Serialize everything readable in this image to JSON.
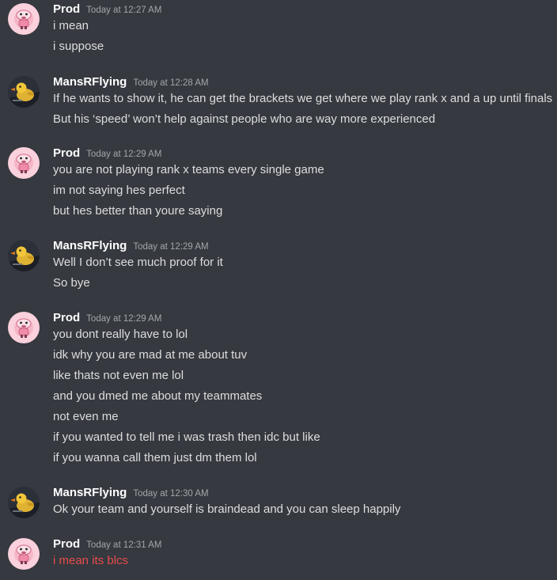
{
  "colors": {
    "background": "#36393f",
    "username": "#ffffff",
    "timestamp": "#a3a6aa",
    "message_text": "#dcddde",
    "highlight_text": "#e74c4c"
  },
  "groups": [
    {
      "author": "Prod",
      "avatar_icon": "pink-cartoon-avatar-icon",
      "timestamp": "Today at 12:27 AM",
      "lines": [
        {
          "text": "i mean"
        },
        {
          "text": "i suppose"
        }
      ]
    },
    {
      "author": "MansRFlying",
      "avatar_icon": "duck-avatar-icon",
      "timestamp": "Today at 12:28 AM",
      "lines": [
        {
          "text": "If he wants to show it, he can get the brackets we get where we play rank x and a up until finals"
        },
        {
          "text": "But his ‘speed’ won’t help against people who are way more experienced"
        }
      ]
    },
    {
      "author": "Prod",
      "avatar_icon": "pink-cartoon-avatar-icon",
      "timestamp": "Today at 12:29 AM",
      "lines": [
        {
          "text": "you are not playing rank x teams every single game"
        },
        {
          "text": "im not saying hes perfect"
        },
        {
          "text": "but hes better than youre saying"
        }
      ]
    },
    {
      "author": "MansRFlying",
      "avatar_icon": "duck-avatar-icon",
      "timestamp": "Today at 12:29 AM",
      "lines": [
        {
          "text": "Well I don’t see much proof for it"
        },
        {
          "text": "So bye"
        }
      ]
    },
    {
      "author": "Prod",
      "avatar_icon": "pink-cartoon-avatar-icon",
      "timestamp": "Today at 12:29 AM",
      "lines": [
        {
          "text": "you dont really have to lol"
        },
        {
          "text": "idk why you are mad at me about tuv"
        },
        {
          "text": "like thats not even me lol"
        },
        {
          "text": "and you dmed me about my teammates"
        },
        {
          "text": "not even me"
        },
        {
          "text": "if you wanted to tell me i was trash then idc but like"
        },
        {
          "text": "if you wanna call them just dm them lol"
        }
      ]
    },
    {
      "author": "MansRFlying",
      "avatar_icon": "duck-avatar-icon",
      "timestamp": "Today at 12:30 AM",
      "lines": [
        {
          "text": "Ok your team and yourself is braindead and you can sleep happily"
        }
      ]
    },
    {
      "author": "Prod",
      "avatar_icon": "pink-cartoon-avatar-icon",
      "timestamp": "Today at 12:31 AM",
      "lines": [
        {
          "text": "i mean its blcs",
          "highlight": true
        }
      ]
    }
  ]
}
